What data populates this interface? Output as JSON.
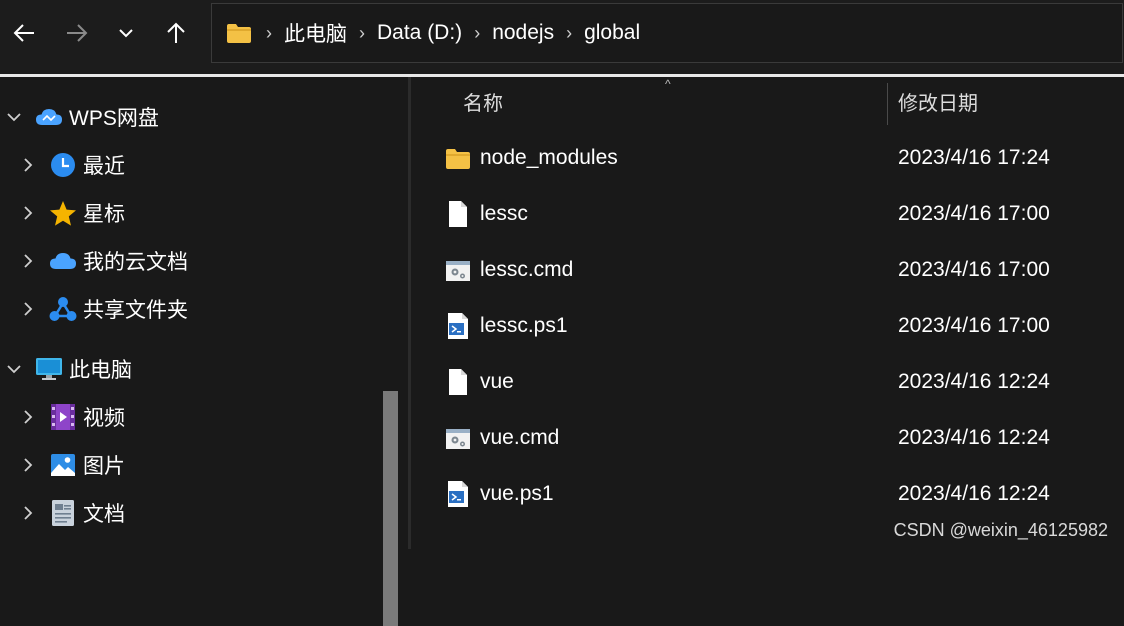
{
  "breadcrumb": [
    "此电脑",
    "Data (D:)",
    "nodejs",
    "global"
  ],
  "breadcrumb_separator": "›",
  "sidebar": {
    "items": [
      {
        "label": "WPS网盘",
        "icon": "wps-cloud-icon",
        "expanded": true
      },
      {
        "label": "最近",
        "icon": "clock-icon"
      },
      {
        "label": "星标",
        "icon": "star-icon"
      },
      {
        "label": "我的云文档",
        "icon": "cloud-icon"
      },
      {
        "label": "共享文件夹",
        "icon": "share-icon"
      },
      {
        "label": "此电脑",
        "icon": "computer-icon",
        "expanded": true
      },
      {
        "label": "视频",
        "icon": "video-icon"
      },
      {
        "label": "图片",
        "icon": "picture-icon"
      },
      {
        "label": "文档",
        "icon": "document-icon"
      }
    ]
  },
  "columns": {
    "name": "名称",
    "modified": "修改日期"
  },
  "files": [
    {
      "name": "node_modules",
      "date": "2023/4/16 17:24",
      "type": "folder"
    },
    {
      "name": "lessc",
      "date": "2023/4/16 17:00",
      "type": "file"
    },
    {
      "name": "lessc.cmd",
      "date": "2023/4/16 17:00",
      "type": "cmd"
    },
    {
      "name": "lessc.ps1",
      "date": "2023/4/16 17:00",
      "type": "ps1"
    },
    {
      "name": "vue",
      "date": "2023/4/16 12:24",
      "type": "file"
    },
    {
      "name": "vue.cmd",
      "date": "2023/4/16 12:24",
      "type": "cmd"
    },
    {
      "name": "vue.ps1",
      "date": "2023/4/16 12:24",
      "type": "ps1"
    }
  ],
  "watermark": "CSDN @weixin_46125982",
  "colors": {
    "background": "#191919",
    "folder": "#f4c145",
    "accent": "#4aa3ff"
  }
}
